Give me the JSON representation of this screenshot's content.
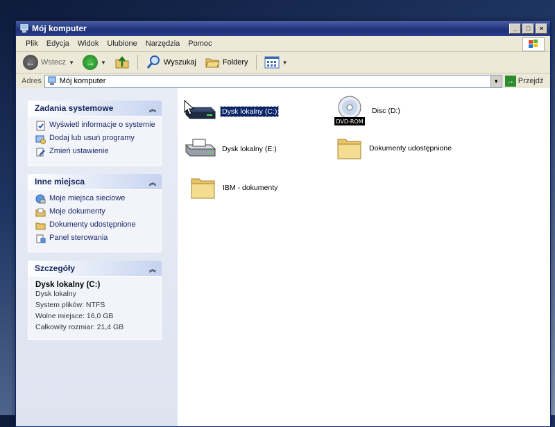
{
  "window": {
    "title": "Mój komputer"
  },
  "title_buttons": {
    "minimize": "_",
    "maximize": "□",
    "close": "×"
  },
  "menu": [
    "Plik",
    "Edycja",
    "Widok",
    "Ulubione",
    "Narzędzia",
    "Pomoc"
  ],
  "toolbar": {
    "back_label": "Wstecz",
    "search_label": "Wyszukaj",
    "folders_label": "Foldery"
  },
  "address": {
    "label": "Adres",
    "value": "Mój komputer",
    "go_label": "Przejdź"
  },
  "panels": {
    "system_tasks": {
      "title": "Zadania systemowe",
      "items": [
        "Wyświetl informacje o systemie",
        "Dodaj lub usuń programy",
        "Zmień ustawienie"
      ]
    },
    "other_places": {
      "title": "Inne miejsca",
      "items": [
        "Moje miejsca sieciowe",
        "Moje dokumenty",
        "Dokumenty udostępnione",
        "Panel sterowania"
      ]
    },
    "details": {
      "title": "Szczegóły",
      "name": "Dysk lokalny (C:)",
      "type": "Dysk lokalny",
      "filesystem": "System plików: NTFS",
      "free": "Wolne miejsce: 16,0 GB",
      "total": "Całkowity rozmiar: 21,4 GB"
    }
  },
  "drives": {
    "c": "Dysk lokalny (C:)",
    "d": "Disc (D:)",
    "d_badge": "DVD-ROM",
    "e": "Dysk lokalny (E:)",
    "shared": "Dokumenty udostępnione",
    "ibm": "IBM - dokumenty"
  },
  "colors": {
    "titlebar": "#1e2f75",
    "selection": "#0a246a",
    "panel_head_text": "#152660"
  }
}
